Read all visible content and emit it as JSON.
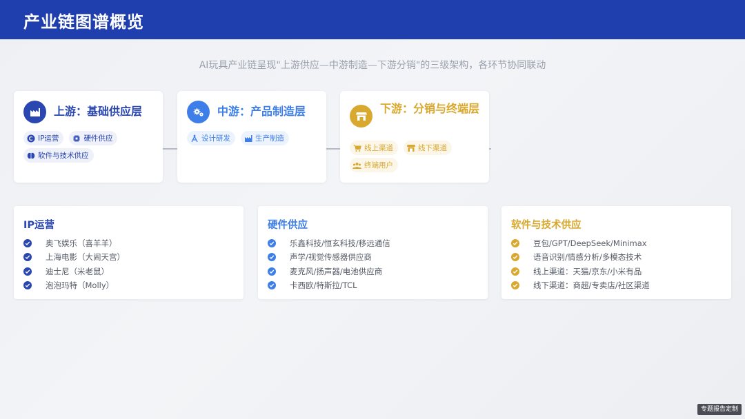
{
  "header": {
    "title": "产业链图谱概览"
  },
  "subtitle": "AI玩具产业链呈现\"上游供应—中游制造—下游分销\"的三级架构，各环节协同联动",
  "colors": {
    "header_bg": "#1f3fae",
    "upstream": "#2a46b0",
    "midstream": "#3d7ee8",
    "downstream": "#d9a82e"
  },
  "stages": [
    {
      "title": "上游：基础供应层",
      "icon": "factory-icon",
      "tags": [
        {
          "label": "IP运营",
          "icon": "copyright-icon"
        },
        {
          "label": "硬件供应",
          "icon": "chip-icon"
        },
        {
          "label": "软件与技术供应",
          "icon": "brain-icon"
        }
      ]
    },
    {
      "title": "中游：产品制造层",
      "icon": "gears-icon",
      "tags": [
        {
          "label": "设计研发",
          "icon": "drafting-compass-icon"
        },
        {
          "label": "生产制造",
          "icon": "industry-icon"
        }
      ]
    },
    {
      "title": "下游：分销与终端层",
      "icon": "store-icon",
      "tags": [
        {
          "label": "线上渠道",
          "icon": "cart-icon"
        },
        {
          "label": "线下渠道",
          "icon": "shop-icon"
        },
        {
          "label": "终端用户",
          "icon": "users-icon"
        }
      ]
    }
  ],
  "details": [
    {
      "title": "IP运营",
      "items": [
        "奥飞娱乐（喜羊羊）",
        "上海电影（大闹天宫）",
        "迪士尼（米老鼠）",
        "泡泡玛特（Molly）"
      ]
    },
    {
      "title": "硬件供应",
      "items": [
        "乐鑫科技/恒玄科技/移远通信",
        "声学/视觉传感器供应商",
        "麦克风/扬声器/电池供应商",
        "卡西欧/特斯拉/TCL"
      ]
    },
    {
      "title": "软件与技术供应",
      "items": [
        "豆包/GPT/DeepSeek/Minimax",
        "语音识别/情感分析/多模态技术",
        "线上渠道：天猫/京东/小米有品",
        "线下渠道：商超/专卖店/社区渠道"
      ]
    }
  ],
  "watermark": "专题报告定制"
}
